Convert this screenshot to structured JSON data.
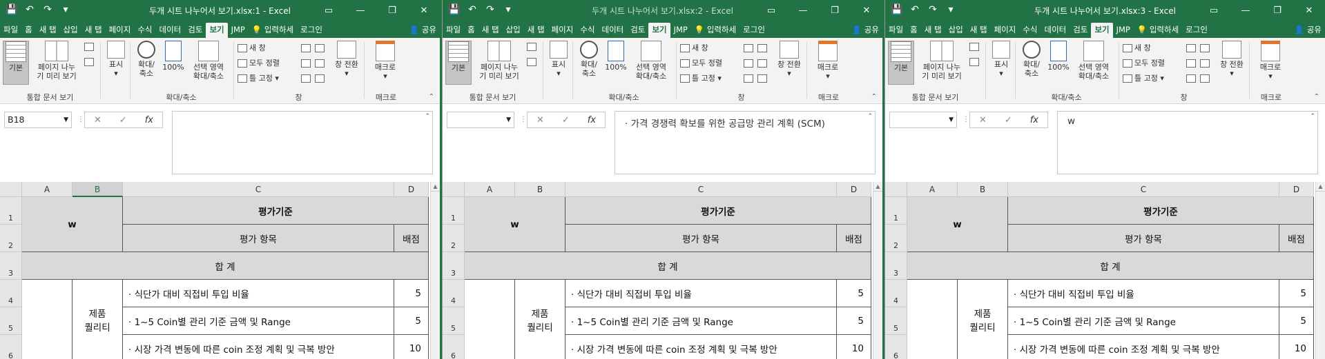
{
  "windows": [
    {
      "title": "두개 시트 나누어서 보기.xlsx:1 - Excel",
      "name_box": "B18",
      "formula": "",
      "selected_col": "B",
      "active": true
    },
    {
      "title": "두개 시트 나누어서 보기.xlsx:2 - Excel",
      "name_box": "",
      "formula": "· 가격 경쟁력 확보를 위한 공급망 관리 계획 (SCM)",
      "selected_col": "",
      "active": false
    },
    {
      "title": "두개 시트 나누어서 보기.xlsx:3 - Excel",
      "name_box": "",
      "formula": "w",
      "selected_col": "",
      "active": true
    }
  ],
  "window_controls": {
    "minimize": "—",
    "restore": "❐",
    "close": "✕"
  },
  "qat": {
    "save": "💾",
    "undo": "↶",
    "redo": "↷",
    "customize": "▾"
  },
  "tabs": [
    "파일",
    "홈",
    "새 탭",
    "삽입",
    "새 탭",
    "페이지",
    "수식",
    "데이터",
    "검토",
    "보기",
    "JMP"
  ],
  "active_tab": "보기",
  "tell_me": "입력하세",
  "login": "로그인",
  "share": "공유",
  "ribbon": {
    "normal": "기본",
    "page_break_1": "페이지 나누",
    "page_break_2": "기 미리 보기",
    "group_workbook_views": "통합 문서 보기",
    "show": "표시",
    "zoom": "확대/",
    "zoom_2": "축소",
    "zoom100": "100%",
    "zoom_sel_1": "선택 영역",
    "zoom_sel_2": "확대/축소",
    "group_zoom": "확대/축소",
    "new_window": "새 창",
    "arrange_all": "모두 정렬",
    "freeze": "틀 고정",
    "switch_windows": "창 전환",
    "group_window": "창",
    "macros": "매크로",
    "group_macros": "매크로"
  },
  "formula_buttons": {
    "cancel": "✕",
    "enter": "✓",
    "fx": "fx"
  },
  "columns": [
    "A",
    "B",
    "C",
    "D"
  ],
  "rows": [
    "1",
    "2",
    "3",
    "4",
    "5",
    "6"
  ],
  "sheet": {
    "w": "w",
    "criteria": "평가기준",
    "item_header": "평가 항목",
    "score_header": "배점",
    "total": "합 계",
    "category_1": "제품",
    "category_2": "퀄리티",
    "items": [
      {
        "text": "· 식단가 대비 직접비 투입  비율",
        "score": "5"
      },
      {
        "text": "· 1~5 Coin별 관리 기준 금액 및 Range",
        "score": "5"
      },
      {
        "text": "· 시장 가격 변동에 따른 coin 조정 계획 및 극복 방안",
        "score": "10"
      }
    ]
  },
  "colors": {
    "excel_green": "#217346",
    "ribbon_bg": "#f3f3f3",
    "header_gray": "#d9d9d9"
  }
}
